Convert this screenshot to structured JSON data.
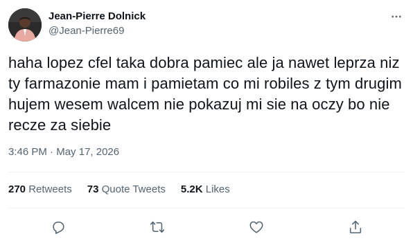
{
  "tweet": {
    "author": {
      "display_name": "Jean-Pierre Dolnick",
      "handle": "@Jean-Pierre69"
    },
    "text": "haha lopez cfel taka dobra pamiec ale ja nawet leprza niz ty farmazonie mam i pamietam co mi robiles z tym drugim hujem wesem walcem nie pokazuj mi sie na oczy bo nie recze za siebie",
    "time": "3:46 PM",
    "separator": "·",
    "date": "May 17, 2026",
    "stats": {
      "retweets_count": "270",
      "retweets_label": "Retweets",
      "quotes_count": "73",
      "quotes_label": "Quote Tweets",
      "likes_count": "5.2K",
      "likes_label": "Likes"
    },
    "icons": {
      "more": "more-icon",
      "reply": "reply-icon",
      "retweet": "retweet-icon",
      "like": "heart-icon",
      "share": "share-icon"
    },
    "colors": {
      "text": "#0f1419",
      "secondary": "#536471",
      "divider": "#eff3f4"
    }
  }
}
